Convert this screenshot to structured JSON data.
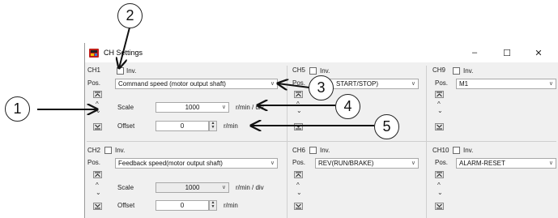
{
  "window": {
    "title": "CH Settings",
    "controls": {
      "minimize": "–",
      "maximize": "☐",
      "close": "✕"
    }
  },
  "channels": {
    "ch1": {
      "label": "CH1",
      "inv_label": "Inv.",
      "pos_label": "Pos.",
      "mode": "Command speed (motor output shaft)",
      "scale_label": "Scale",
      "scale_value": "1000",
      "scale_unit": "r/min / div",
      "offset_label": "Offset",
      "offset_value": "0",
      "offset_unit": "r/min"
    },
    "ch2": {
      "label": "CH2",
      "inv_label": "Inv.",
      "pos_label": "Pos.",
      "mode": "Feedback speed(motor output shaft)",
      "scale_label": "Scale",
      "scale_value": "1000",
      "scale_unit": "r/min / div",
      "offset_label": "Offset",
      "offset_value": "0",
      "offset_unit": "r/min"
    },
    "ch5": {
      "label": "CH5",
      "inv_label": "Inv.",
      "pos_label": "Pos.",
      "mode": "START/STOP)"
    },
    "ch6": {
      "label": "CH6",
      "inv_label": "Inv.",
      "pos_label": "Pos.",
      "mode": "REV(RUN/BRAKE)"
    },
    "ch9": {
      "label": "CH9",
      "inv_label": "Inv.",
      "pos_label": "Pos.",
      "mode": "M1"
    },
    "ch10": {
      "label": "CH10",
      "inv_label": "Inv.",
      "pos_label": "Pos.",
      "mode": "ALARM-RESET"
    }
  },
  "callouts": {
    "c1": "1",
    "c2": "2",
    "c3": "3",
    "c4": "4",
    "c5": "5"
  },
  "glyphs": {
    "up": "^",
    "down": "⌄",
    "spin_up": "▲",
    "spin_down": "▼",
    "dropdown": "∨"
  }
}
